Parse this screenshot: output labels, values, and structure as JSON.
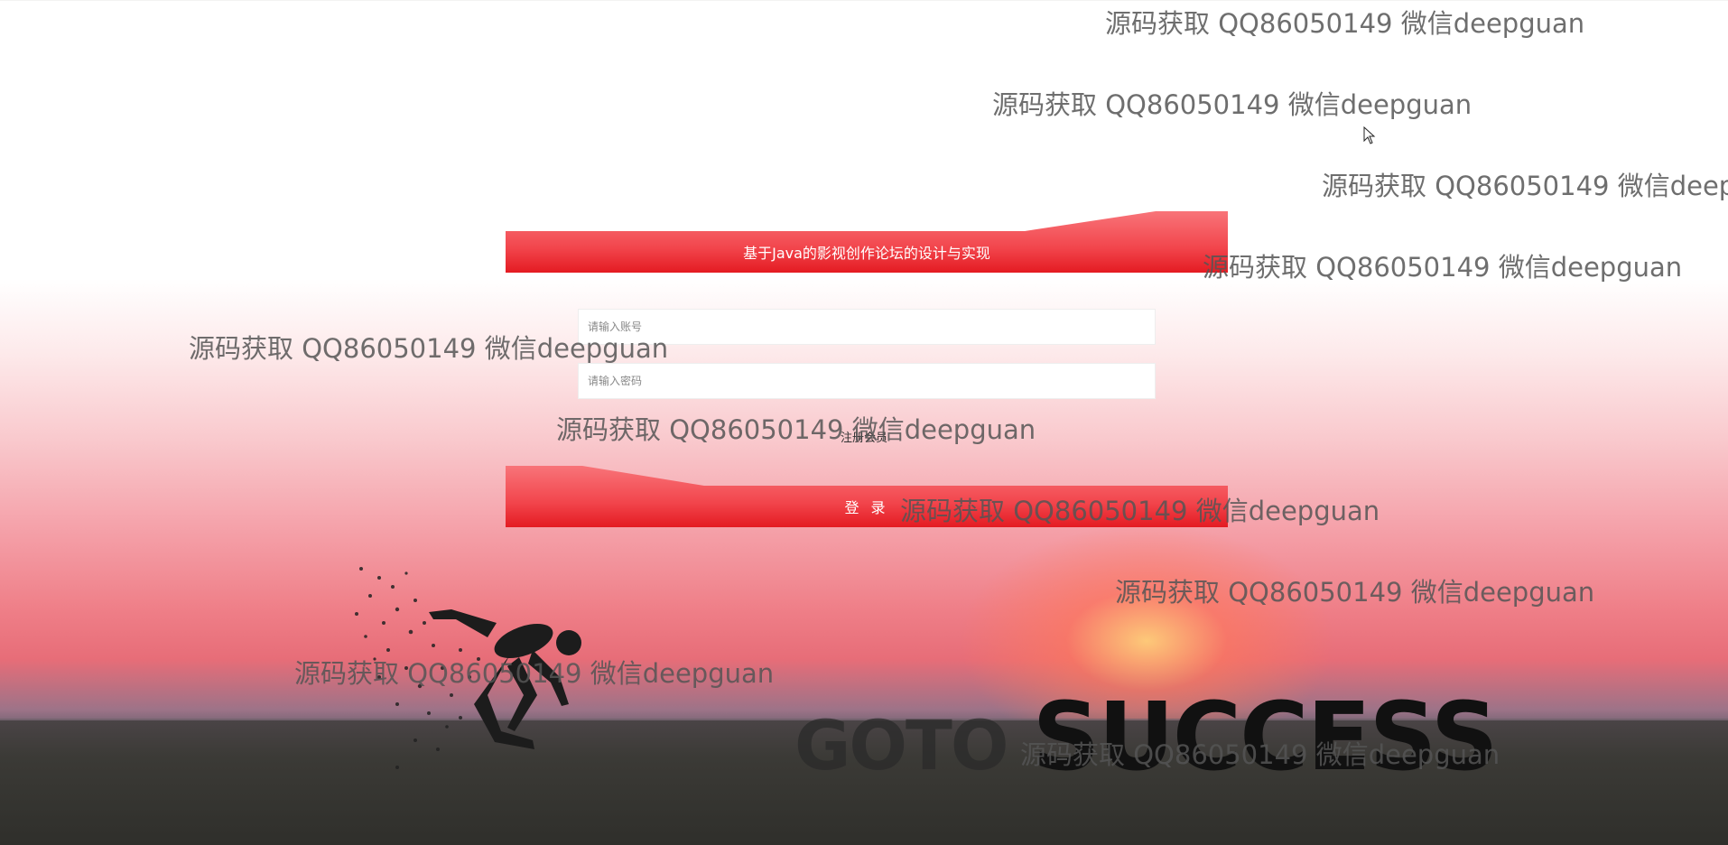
{
  "title": "基于Java的影视创作论坛的设计与实现",
  "form": {
    "account_placeholder": "请输入账号",
    "password_placeholder": "请输入密码",
    "register_link": "注册会员",
    "login_button": "登 录"
  },
  "background": {
    "slogan_goto": "GOTO",
    "slogan_success": "SUCCESS"
  },
  "watermark_text": "源码获取 QQ86050149 微信deepguan",
  "colors": {
    "accent": "#f0323a",
    "accent_light": "#f8676d"
  }
}
